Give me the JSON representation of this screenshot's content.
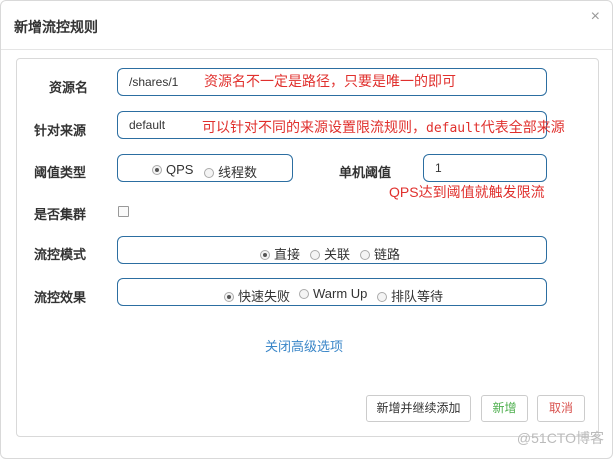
{
  "dialog": {
    "title": "新增流控规则",
    "close_glyph": "×"
  },
  "form": {
    "resource": {
      "label": "资源名",
      "value": "/shares/1",
      "note": "资源名不一定是路径，只要是唯一的即可"
    },
    "limit_app": {
      "label": "针对来源",
      "value": "default",
      "note_prefix": "可以针对不同的来源设置限流规则，",
      "note_code": "default",
      "note_suffix": "代表全部来源"
    },
    "grade": {
      "label": "阈值类型",
      "options": [
        "QPS",
        "线程数"
      ],
      "selected": "QPS"
    },
    "threshold": {
      "label": "单机阈值",
      "value": "1",
      "note": "QPS达到阈值就触发限流"
    },
    "cluster": {
      "label": "是否集群",
      "checked": false
    },
    "strategy": {
      "label": "流控模式",
      "options": [
        "直接",
        "关联",
        "链路"
      ],
      "selected": "直接"
    },
    "control_behavior": {
      "label": "流控效果",
      "options": [
        "快速失败",
        "Warm Up",
        "排队等待"
      ],
      "selected": "快速失败"
    },
    "advanced_link": "关闭高级选项"
  },
  "footer": {
    "add_continue": "新增并继续添加",
    "add": "新增",
    "cancel": "取消"
  },
  "watermark": "@51CTO博客",
  "colors": {
    "input_border": "#2c6ea1",
    "note_red": "#e0302d",
    "link_blue": "#3a86c8",
    "add_green": "#4cae4c",
    "cancel_red": "#d9534f"
  }
}
